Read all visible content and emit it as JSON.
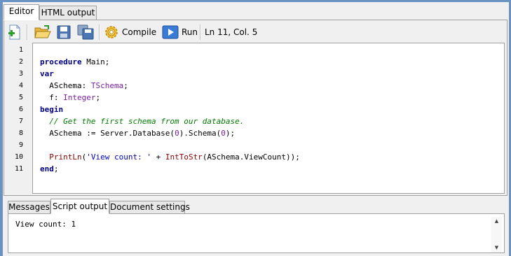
{
  "tabs": {
    "editor": "Editor",
    "html_output": "HTML output"
  },
  "toolbar": {
    "compile": "Compile",
    "run": "Run",
    "status": "Ln 11, Col. 5"
  },
  "code": {
    "line_numbers": [
      "1",
      "2",
      "3",
      "4",
      "5",
      "6",
      "7",
      "8",
      "9",
      "10",
      "11"
    ],
    "lines": [
      "",
      "procedure Main;",
      "var",
      "  ASchema: TSchema;",
      "  f: Integer;",
      "begin",
      "  // Get the first schema from our database.",
      "  ASchema := Server.Database(0).Schema(0);",
      "",
      "  PrintLn('View count: ' + IntToStr(ASchema.ViewCount));",
      "end;"
    ]
  },
  "bottom_tabs": {
    "messages": "Messages",
    "script_output": "Script output",
    "document_settings": "Document settings"
  },
  "output": {
    "text": "View count: 1"
  }
}
